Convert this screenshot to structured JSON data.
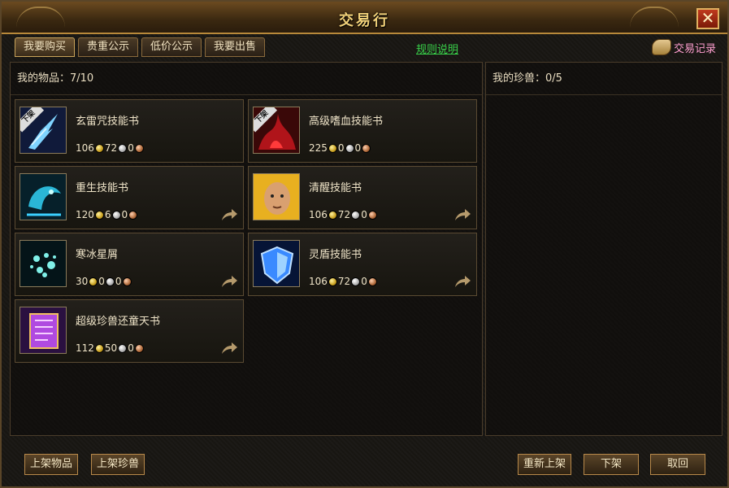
{
  "window": {
    "title": "交易行",
    "close_label": "✕"
  },
  "tabs": [
    {
      "label": "我要购买"
    },
    {
      "label": "贵重公示"
    },
    {
      "label": "低价公示"
    },
    {
      "label": "我要出售"
    }
  ],
  "rules_link": "规则说明",
  "history": {
    "label": "交易记录",
    "icon": "scroll-icon"
  },
  "left_panel": {
    "header": "我的物品：7/10"
  },
  "right_panel": {
    "header": "我的珍兽：0/5"
  },
  "items": [
    {
      "name": "玄雷咒技能书",
      "gold": "106",
      "silver": "72",
      "copper": "0",
      "tag": "下架",
      "icon": "lightning-skill-icon"
    },
    {
      "name": "高级嗜血技能书",
      "gold": "225",
      "silver": "0",
      "copper": "0",
      "tag": "下架",
      "icon": "blood-skill-icon"
    },
    {
      "name": "重生技能书",
      "gold": "120",
      "silver": "6",
      "copper": "0",
      "tag": "",
      "icon": "rebirth-skill-icon"
    },
    {
      "name": "清醒技能书",
      "gold": "106",
      "silver": "72",
      "copper": "0",
      "tag": "",
      "icon": "monk-portrait-icon"
    },
    {
      "name": "寒冰星屑",
      "gold": "30",
      "silver": "0",
      "copper": "0",
      "tag": "",
      "icon": "ice-stardust-icon"
    },
    {
      "name": "灵盾技能书",
      "gold": "106",
      "silver": "72",
      "copper": "0",
      "tag": "",
      "icon": "shield-skill-icon"
    },
    {
      "name": "超级珍兽还童天书",
      "gold": "112",
      "silver": "50",
      "copper": "0",
      "tag": "",
      "icon": "scroll-book-icon"
    }
  ],
  "buttons": {
    "list_item": "上架物品",
    "list_pet": "上架珍兽",
    "relist": "重新上架",
    "delist": "下架",
    "fetch": "取回"
  }
}
